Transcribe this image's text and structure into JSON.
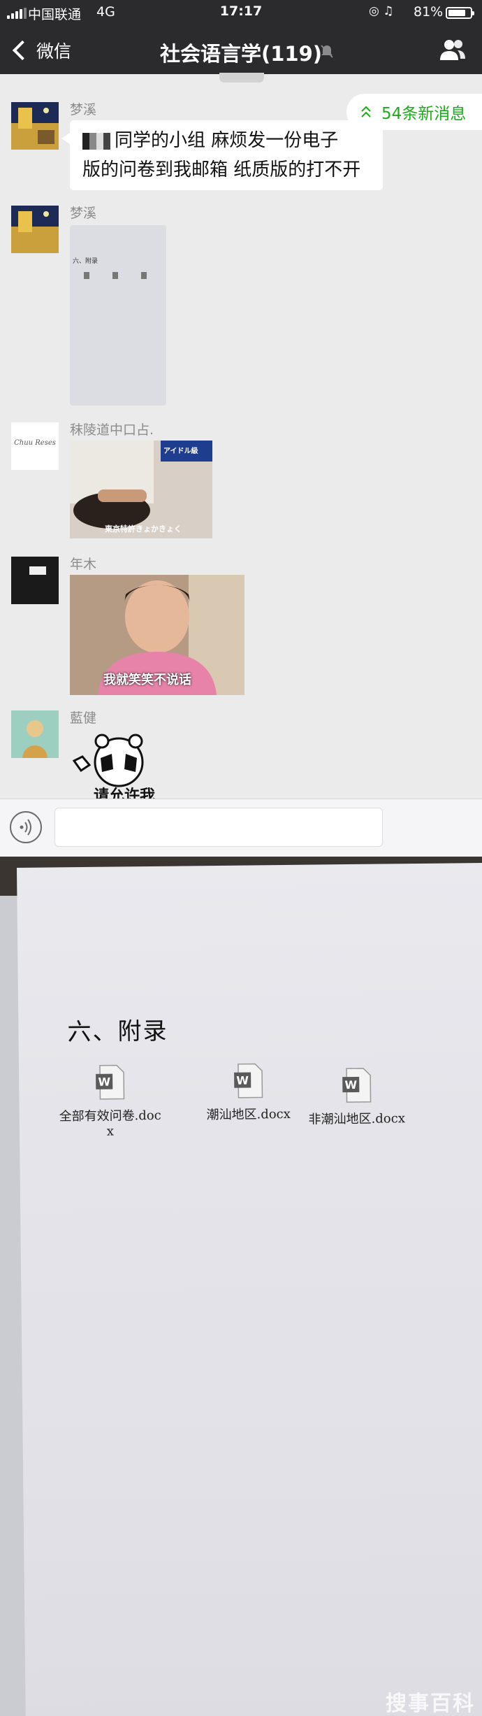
{
  "status_bar": {
    "carrier": "中国联通",
    "network": "4G",
    "time": "17:17",
    "battery": "81%",
    "battery_level": 0.81
  },
  "nav": {
    "back_label": "微信",
    "title": "社会语言学(119)"
  },
  "unread_banner": {
    "label": "54条新消息"
  },
  "messages": [
    {
      "sender": "梦溪",
      "text_line1": "同学的小组 麻烦发一份电子",
      "text_line2": "版的问卷到我邮箱 纸质版的打不开"
    },
    {
      "sender": "梦溪",
      "thumb_heading": "六、附录"
    },
    {
      "sender": "秣陵道中口占.",
      "avatar_text": "Chuu Reses",
      "sticker_badge": "アイドル級",
      "sticker_caption": "東京特許きょかきょく"
    },
    {
      "sender": "年木",
      "sticker_caption": "我就笑笑不说话"
    },
    {
      "sender": "藍健",
      "sticker_caption": "请允许我"
    }
  ],
  "photo": {
    "heading": "六、附录",
    "files": [
      {
        "line1": "全部有效问卷.doc",
        "line2": "x"
      },
      {
        "line1": "潮汕地区.docx",
        "line2": ""
      },
      {
        "line1": "非潮汕地区.docx",
        "line2": ""
      }
    ],
    "watermark": "搜事百科"
  },
  "colors": {
    "nav_bg": "#2b2b2d",
    "chat_bg": "#ebebeb",
    "accent_green": "#1aad19"
  },
  "icons": [
    "signal-icon",
    "chevron-left-icon",
    "mute-icon",
    "group-members-icon",
    "double-chevron-up-icon",
    "voice-icon",
    "word-doc-icon"
  ]
}
